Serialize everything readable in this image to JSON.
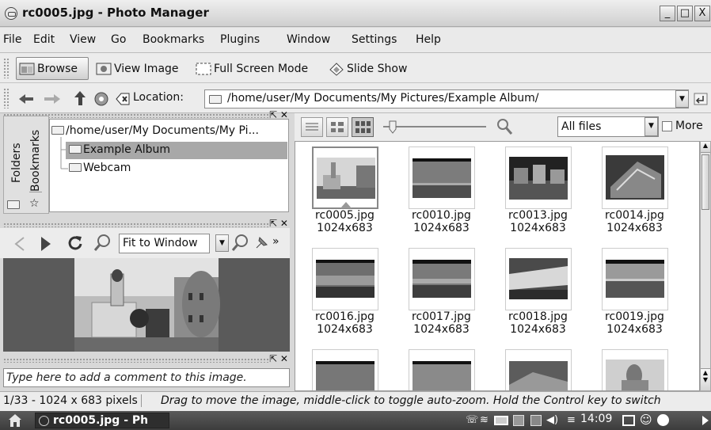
{
  "window": {
    "title": "rc0005.jpg - Photo Manager",
    "buttons": [
      "_",
      "□",
      "X"
    ]
  },
  "menu": [
    "File",
    "Edit",
    "View",
    "Go",
    "Bookmarks",
    "Plugins",
    "Window",
    "Settings",
    "Help"
  ],
  "toolbar": {
    "browse": "Browse",
    "view_image": "View Image",
    "full_screen": "Full Screen Mode",
    "slide_show": "Slide Show"
  },
  "location": {
    "label": "Location:",
    "path": "/home/user/My Documents/My Pictures/Example Album/"
  },
  "sidebar": {
    "tabs": [
      "Folders",
      "Bookmarks"
    ],
    "root": "/home/user/My Documents/My Pi...",
    "folders": [
      "Example Album",
      "Webcam"
    ]
  },
  "preview_toolbar": {
    "zoom_mode": "Fit to Window",
    "more": "»"
  },
  "comment_placeholder": "Type here to add a comment to this image.",
  "grid_toolbar": {
    "filter": "All files",
    "more_label": "More"
  },
  "thumbnails": [
    {
      "name": "rc0005.jpg",
      "size": "1024x683"
    },
    {
      "name": "rc0010.jpg",
      "size": "1024x683"
    },
    {
      "name": "rc0013.jpg",
      "size": "1024x683"
    },
    {
      "name": "rc0014.jpg",
      "size": "1024x683"
    },
    {
      "name": "rc0016.jpg",
      "size": "1024x683"
    },
    {
      "name": "rc0017.jpg",
      "size": "1024x683"
    },
    {
      "name": "rc0018.jpg",
      "size": "1024x683"
    },
    {
      "name": "rc0019.jpg",
      "size": "1024x683"
    },
    {
      "name": "",
      "size": ""
    },
    {
      "name": "",
      "size": ""
    },
    {
      "name": "",
      "size": ""
    },
    {
      "name": "",
      "size": ""
    }
  ],
  "status": {
    "info": "1/33 - 1024 x 683 pixels",
    "hint": "Drag to move the image, middle-click to toggle auto-zoom. Hold the Control key to switch"
  },
  "taskbar": {
    "task": "rc0005.jpg - Ph",
    "clock": "14:09"
  }
}
